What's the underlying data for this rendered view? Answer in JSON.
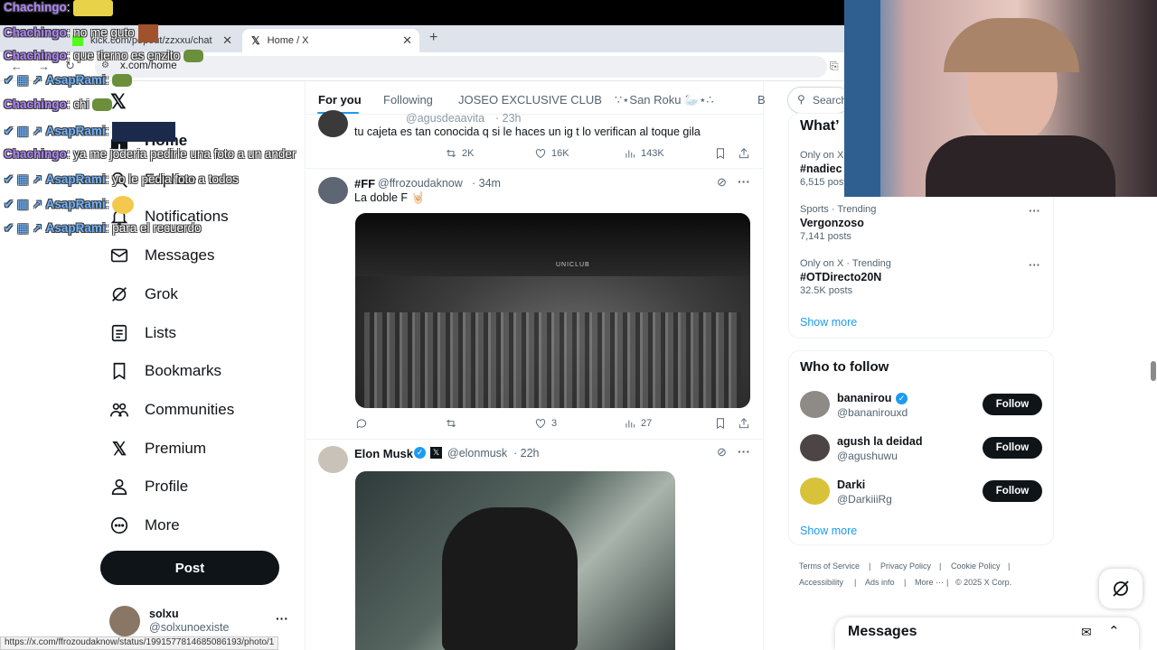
{
  "browser": {
    "tabs": [
      {
        "title": "kick.com/popout/zzxxu/chat",
        "active": false
      },
      {
        "title": "Home / X",
        "active": true
      }
    ],
    "url": "x.com/home",
    "status_url": "https://x.com/ffrozoudaknow/status/1991577814685086193/photo/1"
  },
  "nav": {
    "home": "Home",
    "explore": "Explore",
    "notifications": "Notifications",
    "messages": "Messages",
    "grok": "Grok",
    "lists": "Lists",
    "bookmarks": "Bookmarks",
    "communities": "Communities",
    "premium": "Premium",
    "profile": "Profile",
    "more": "More",
    "post": "Post"
  },
  "account": {
    "name": "solxu",
    "handle": "@solxunoexiste"
  },
  "feed_tabs": [
    "For you",
    "Following",
    "JOSEO EXCLUSIVE CLUB",
    "∵⋆San Roku 🦢⋆∴",
    "B"
  ],
  "search_placeholder": "Search",
  "tweets": [
    {
      "handle": "@agusdeaavita",
      "time": "23h",
      "text": "tu cajeta es tan conocida q si le haces un ig t lo verifican al toque gila",
      "retweets": "2K",
      "likes": "16K",
      "views": "143K"
    },
    {
      "name": "#FF",
      "handle": "@ffrozoudaknow",
      "time": "34m",
      "text": "La doble F 🤘🏻",
      "image_label": "UNICLUB",
      "retweets": "",
      "likes": "3",
      "views": "27"
    },
    {
      "name": "Elon Musk",
      "handle": "@elonmusk",
      "time": "22h"
    }
  ],
  "trending": [
    {
      "context": "Only on X · Trending",
      "tag": "#nadiec",
      "posts": "6,515 posts"
    },
    {
      "context": "Sports · Trending",
      "tag": "Vergonzoso",
      "posts": "7,141 posts"
    },
    {
      "context": "Only on X · Trending",
      "tag": "#OTDirecto20N",
      "posts": "32.5K posts"
    }
  ],
  "trending_title": "What’",
  "show_more": "Show more",
  "who_to_follow": {
    "title": "Who to follow",
    "users": [
      {
        "name": "bananirou",
        "handle": "@bananirouxd",
        "verified": true
      },
      {
        "name": "agush la deidad",
        "handle": "@agushuwu",
        "verified": false
      },
      {
        "name": "Darki",
        "handle": "@DarkiiiRg",
        "verified": false
      }
    ],
    "follow_label": "Follow"
  },
  "footer": {
    "line1": [
      "Terms of Service",
      "Privacy Policy",
      "Cookie Policy"
    ],
    "line2": [
      "Accessibility",
      "Ads info",
      "More ···",
      "© 2025 X Corp."
    ]
  },
  "messages_drawer": "Messages",
  "chat_overlay": [
    {
      "user": "Chachingo",
      "msg": ""
    },
    {
      "user": "Chachingo",
      "msg": "no me guto"
    },
    {
      "user": "Chachingo",
      "msg": "que tierno es enzito"
    },
    {
      "user": "AsapRami",
      "msg": ""
    },
    {
      "user": "Chachingo",
      "msg": "chi"
    },
    {
      "user": "AsapRami",
      "msg": ""
    },
    {
      "user": "Chachingo",
      "msg": "ya me joderia pedirle una foto a un ander"
    },
    {
      "user": "AsapRami",
      "msg": "yo le pedia foto a todos"
    },
    {
      "user": "AsapRami",
      "msg": ""
    },
    {
      "user": "AsapRami",
      "msg": "para el recuerdo"
    }
  ]
}
